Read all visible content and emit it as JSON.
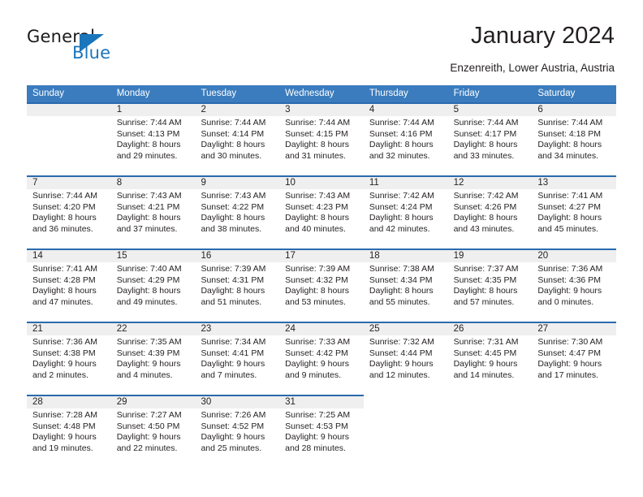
{
  "brand": {
    "name_top": "General",
    "name_bottom": "Blue",
    "accent_color": "#1b75bb"
  },
  "header": {
    "title": "January 2024",
    "subtitle": "Enzenreith, Lower Austria, Austria"
  },
  "theme": {
    "header_bg": "#3a7cbe",
    "week_separator": "#2a6aad",
    "date_band": "#efefef",
    "text": "#231f20"
  },
  "weekdays": [
    "Sunday",
    "Monday",
    "Tuesday",
    "Wednesday",
    "Thursday",
    "Friday",
    "Saturday"
  ],
  "labels": {
    "sunrise": "Sunrise:",
    "sunset": "Sunset:",
    "daylight": "Daylight:"
  },
  "weeks": [
    {
      "filled_columns": 7,
      "days": [
        {
          "empty": true
        },
        {
          "day": "1",
          "sunrise": "Sunrise: 7:44 AM",
          "sunset": "Sunset: 4:13 PM",
          "daylight_line1": "Daylight: 8 hours",
          "daylight_line2": "and 29 minutes."
        },
        {
          "day": "2",
          "sunrise": "Sunrise: 7:44 AM",
          "sunset": "Sunset: 4:14 PM",
          "daylight_line1": "Daylight: 8 hours",
          "daylight_line2": "and 30 minutes."
        },
        {
          "day": "3",
          "sunrise": "Sunrise: 7:44 AM",
          "sunset": "Sunset: 4:15 PM",
          "daylight_line1": "Daylight: 8 hours",
          "daylight_line2": "and 31 minutes."
        },
        {
          "day": "4",
          "sunrise": "Sunrise: 7:44 AM",
          "sunset": "Sunset: 4:16 PM",
          "daylight_line1": "Daylight: 8 hours",
          "daylight_line2": "and 32 minutes."
        },
        {
          "day": "5",
          "sunrise": "Sunrise: 7:44 AM",
          "sunset": "Sunset: 4:17 PM",
          "daylight_line1": "Daylight: 8 hours",
          "daylight_line2": "and 33 minutes."
        },
        {
          "day": "6",
          "sunrise": "Sunrise: 7:44 AM",
          "sunset": "Sunset: 4:18 PM",
          "daylight_line1": "Daylight: 8 hours",
          "daylight_line2": "and 34 minutes."
        }
      ]
    },
    {
      "filled_columns": 7,
      "days": [
        {
          "day": "7",
          "sunrise": "Sunrise: 7:44 AM",
          "sunset": "Sunset: 4:20 PM",
          "daylight_line1": "Daylight: 8 hours",
          "daylight_line2": "and 36 minutes."
        },
        {
          "day": "8",
          "sunrise": "Sunrise: 7:43 AM",
          "sunset": "Sunset: 4:21 PM",
          "daylight_line1": "Daylight: 8 hours",
          "daylight_line2": "and 37 minutes."
        },
        {
          "day": "9",
          "sunrise": "Sunrise: 7:43 AM",
          "sunset": "Sunset: 4:22 PM",
          "daylight_line1": "Daylight: 8 hours",
          "daylight_line2": "and 38 minutes."
        },
        {
          "day": "10",
          "sunrise": "Sunrise: 7:43 AM",
          "sunset": "Sunset: 4:23 PM",
          "daylight_line1": "Daylight: 8 hours",
          "daylight_line2": "and 40 minutes."
        },
        {
          "day": "11",
          "sunrise": "Sunrise: 7:42 AM",
          "sunset": "Sunset: 4:24 PM",
          "daylight_line1": "Daylight: 8 hours",
          "daylight_line2": "and 42 minutes."
        },
        {
          "day": "12",
          "sunrise": "Sunrise: 7:42 AM",
          "sunset": "Sunset: 4:26 PM",
          "daylight_line1": "Daylight: 8 hours",
          "daylight_line2": "and 43 minutes."
        },
        {
          "day": "13",
          "sunrise": "Sunrise: 7:41 AM",
          "sunset": "Sunset: 4:27 PM",
          "daylight_line1": "Daylight: 8 hours",
          "daylight_line2": "and 45 minutes."
        }
      ]
    },
    {
      "filled_columns": 7,
      "days": [
        {
          "day": "14",
          "sunrise": "Sunrise: 7:41 AM",
          "sunset": "Sunset: 4:28 PM",
          "daylight_line1": "Daylight: 8 hours",
          "daylight_line2": "and 47 minutes."
        },
        {
          "day": "15",
          "sunrise": "Sunrise: 7:40 AM",
          "sunset": "Sunset: 4:29 PM",
          "daylight_line1": "Daylight: 8 hours",
          "daylight_line2": "and 49 minutes."
        },
        {
          "day": "16",
          "sunrise": "Sunrise: 7:39 AM",
          "sunset": "Sunset: 4:31 PM",
          "daylight_line1": "Daylight: 8 hours",
          "daylight_line2": "and 51 minutes."
        },
        {
          "day": "17",
          "sunrise": "Sunrise: 7:39 AM",
          "sunset": "Sunset: 4:32 PM",
          "daylight_line1": "Daylight: 8 hours",
          "daylight_line2": "and 53 minutes."
        },
        {
          "day": "18",
          "sunrise": "Sunrise: 7:38 AM",
          "sunset": "Sunset: 4:34 PM",
          "daylight_line1": "Daylight: 8 hours",
          "daylight_line2": "and 55 minutes."
        },
        {
          "day": "19",
          "sunrise": "Sunrise: 7:37 AM",
          "sunset": "Sunset: 4:35 PM",
          "daylight_line1": "Daylight: 8 hours",
          "daylight_line2": "and 57 minutes."
        },
        {
          "day": "20",
          "sunrise": "Sunrise: 7:36 AM",
          "sunset": "Sunset: 4:36 PM",
          "daylight_line1": "Daylight: 9 hours",
          "daylight_line2": "and 0 minutes."
        }
      ]
    },
    {
      "filled_columns": 7,
      "days": [
        {
          "day": "21",
          "sunrise": "Sunrise: 7:36 AM",
          "sunset": "Sunset: 4:38 PM",
          "daylight_line1": "Daylight: 9 hours",
          "daylight_line2": "and 2 minutes."
        },
        {
          "day": "22",
          "sunrise": "Sunrise: 7:35 AM",
          "sunset": "Sunset: 4:39 PM",
          "daylight_line1": "Daylight: 9 hours",
          "daylight_line2": "and 4 minutes."
        },
        {
          "day": "23",
          "sunrise": "Sunrise: 7:34 AM",
          "sunset": "Sunset: 4:41 PM",
          "daylight_line1": "Daylight: 9 hours",
          "daylight_line2": "and 7 minutes."
        },
        {
          "day": "24",
          "sunrise": "Sunrise: 7:33 AM",
          "sunset": "Sunset: 4:42 PM",
          "daylight_line1": "Daylight: 9 hours",
          "daylight_line2": "and 9 minutes."
        },
        {
          "day": "25",
          "sunrise": "Sunrise: 7:32 AM",
          "sunset": "Sunset: 4:44 PM",
          "daylight_line1": "Daylight: 9 hours",
          "daylight_line2": "and 12 minutes."
        },
        {
          "day": "26",
          "sunrise": "Sunrise: 7:31 AM",
          "sunset": "Sunset: 4:45 PM",
          "daylight_line1": "Daylight: 9 hours",
          "daylight_line2": "and 14 minutes."
        },
        {
          "day": "27",
          "sunrise": "Sunrise: 7:30 AM",
          "sunset": "Sunset: 4:47 PM",
          "daylight_line1": "Daylight: 9 hours",
          "daylight_line2": "and 17 minutes."
        }
      ]
    },
    {
      "filled_columns": 4,
      "days": [
        {
          "day": "28",
          "sunrise": "Sunrise: 7:28 AM",
          "sunset": "Sunset: 4:48 PM",
          "daylight_line1": "Daylight: 9 hours",
          "daylight_line2": "and 19 minutes."
        },
        {
          "day": "29",
          "sunrise": "Sunrise: 7:27 AM",
          "sunset": "Sunset: 4:50 PM",
          "daylight_line1": "Daylight: 9 hours",
          "daylight_line2": "and 22 minutes."
        },
        {
          "day": "30",
          "sunrise": "Sunrise: 7:26 AM",
          "sunset": "Sunset: 4:52 PM",
          "daylight_line1": "Daylight: 9 hours",
          "daylight_line2": "and 25 minutes."
        },
        {
          "day": "31",
          "sunrise": "Sunrise: 7:25 AM",
          "sunset": "Sunset: 4:53 PM",
          "daylight_line1": "Daylight: 9 hours",
          "daylight_line2": "and 28 minutes."
        },
        {
          "empty": true
        },
        {
          "empty": true
        },
        {
          "empty": true
        }
      ]
    }
  ]
}
